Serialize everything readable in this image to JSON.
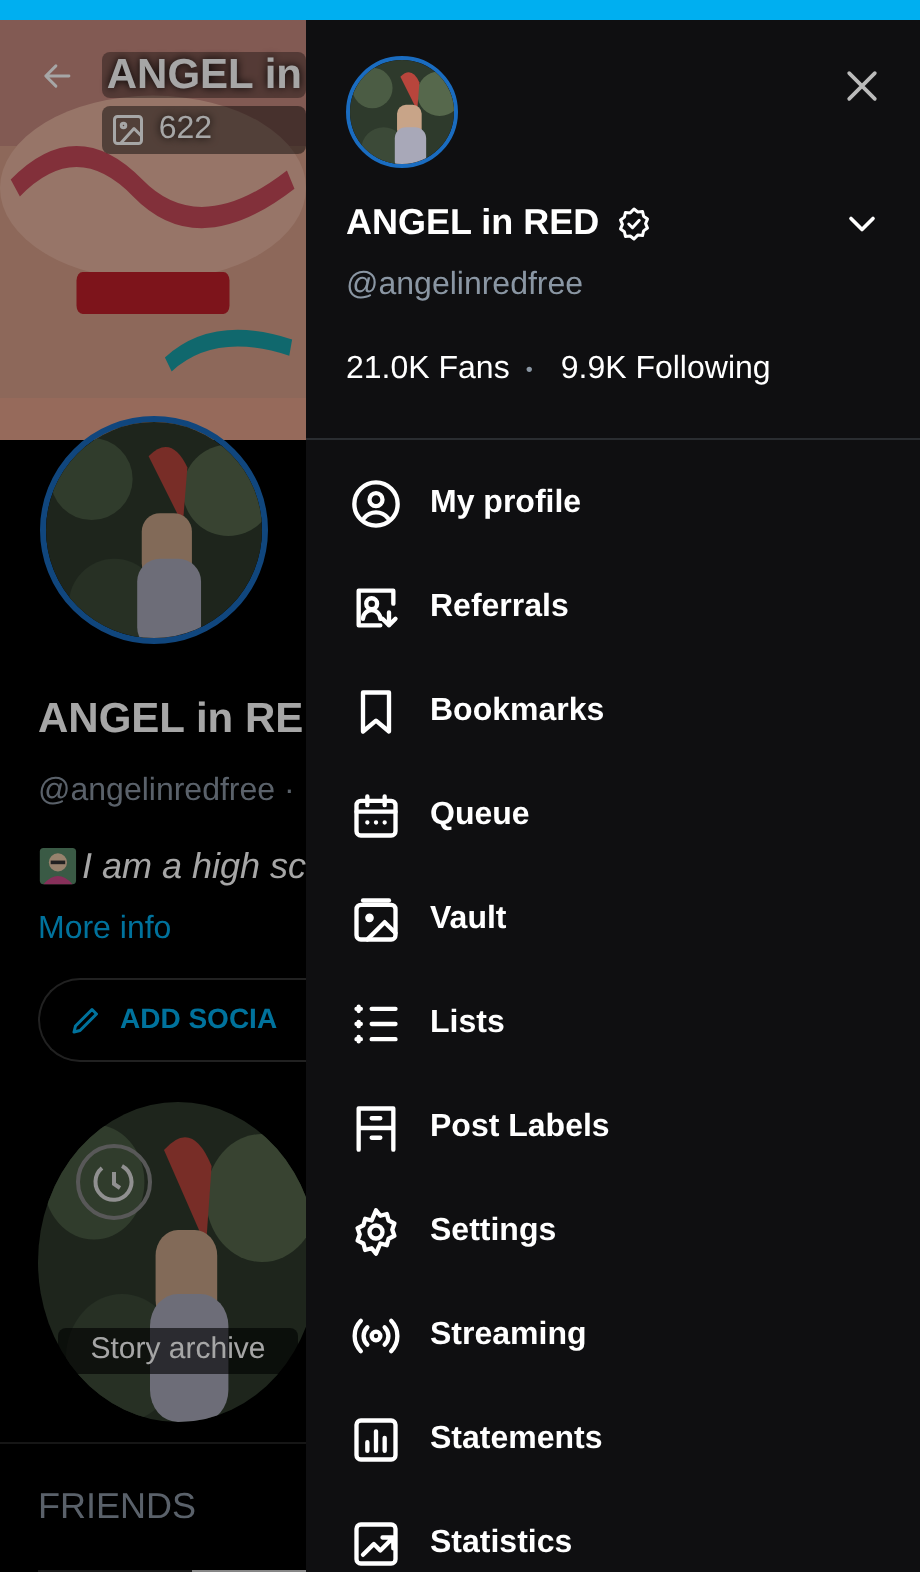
{
  "profile_page": {
    "title": "ANGEL in",
    "posts_count": "622",
    "name": "ANGEL in RE",
    "handle": "@angelinredfree ·",
    "bio": "I am a high sc",
    "more_info": "More info",
    "add_social_button": "ADD SOCIA",
    "story_archive": "Story archive",
    "friends_heading": "FRIENDS"
  },
  "drawer": {
    "name": "ANGEL in RED",
    "verified": true,
    "handle": "@angelinredfree",
    "fans": "21.0K Fans",
    "separator": "•",
    "following": "9.9K Following",
    "menu": [
      {
        "label": "My profile",
        "kind": "profile"
      },
      {
        "label": "Referrals",
        "kind": "referrals"
      },
      {
        "label": "Bookmarks",
        "kind": "bookmark"
      },
      {
        "label": "Queue",
        "kind": "calendar"
      },
      {
        "label": "Vault",
        "kind": "vault"
      },
      {
        "label": "Lists",
        "kind": "list"
      },
      {
        "label": "Post Labels",
        "kind": "labels"
      },
      {
        "label": "Settings",
        "kind": "settings"
      },
      {
        "label": "Streaming",
        "kind": "streaming"
      },
      {
        "label": "Statements",
        "kind": "statements"
      },
      {
        "label": "Statistics",
        "kind": "statistics"
      }
    ]
  }
}
